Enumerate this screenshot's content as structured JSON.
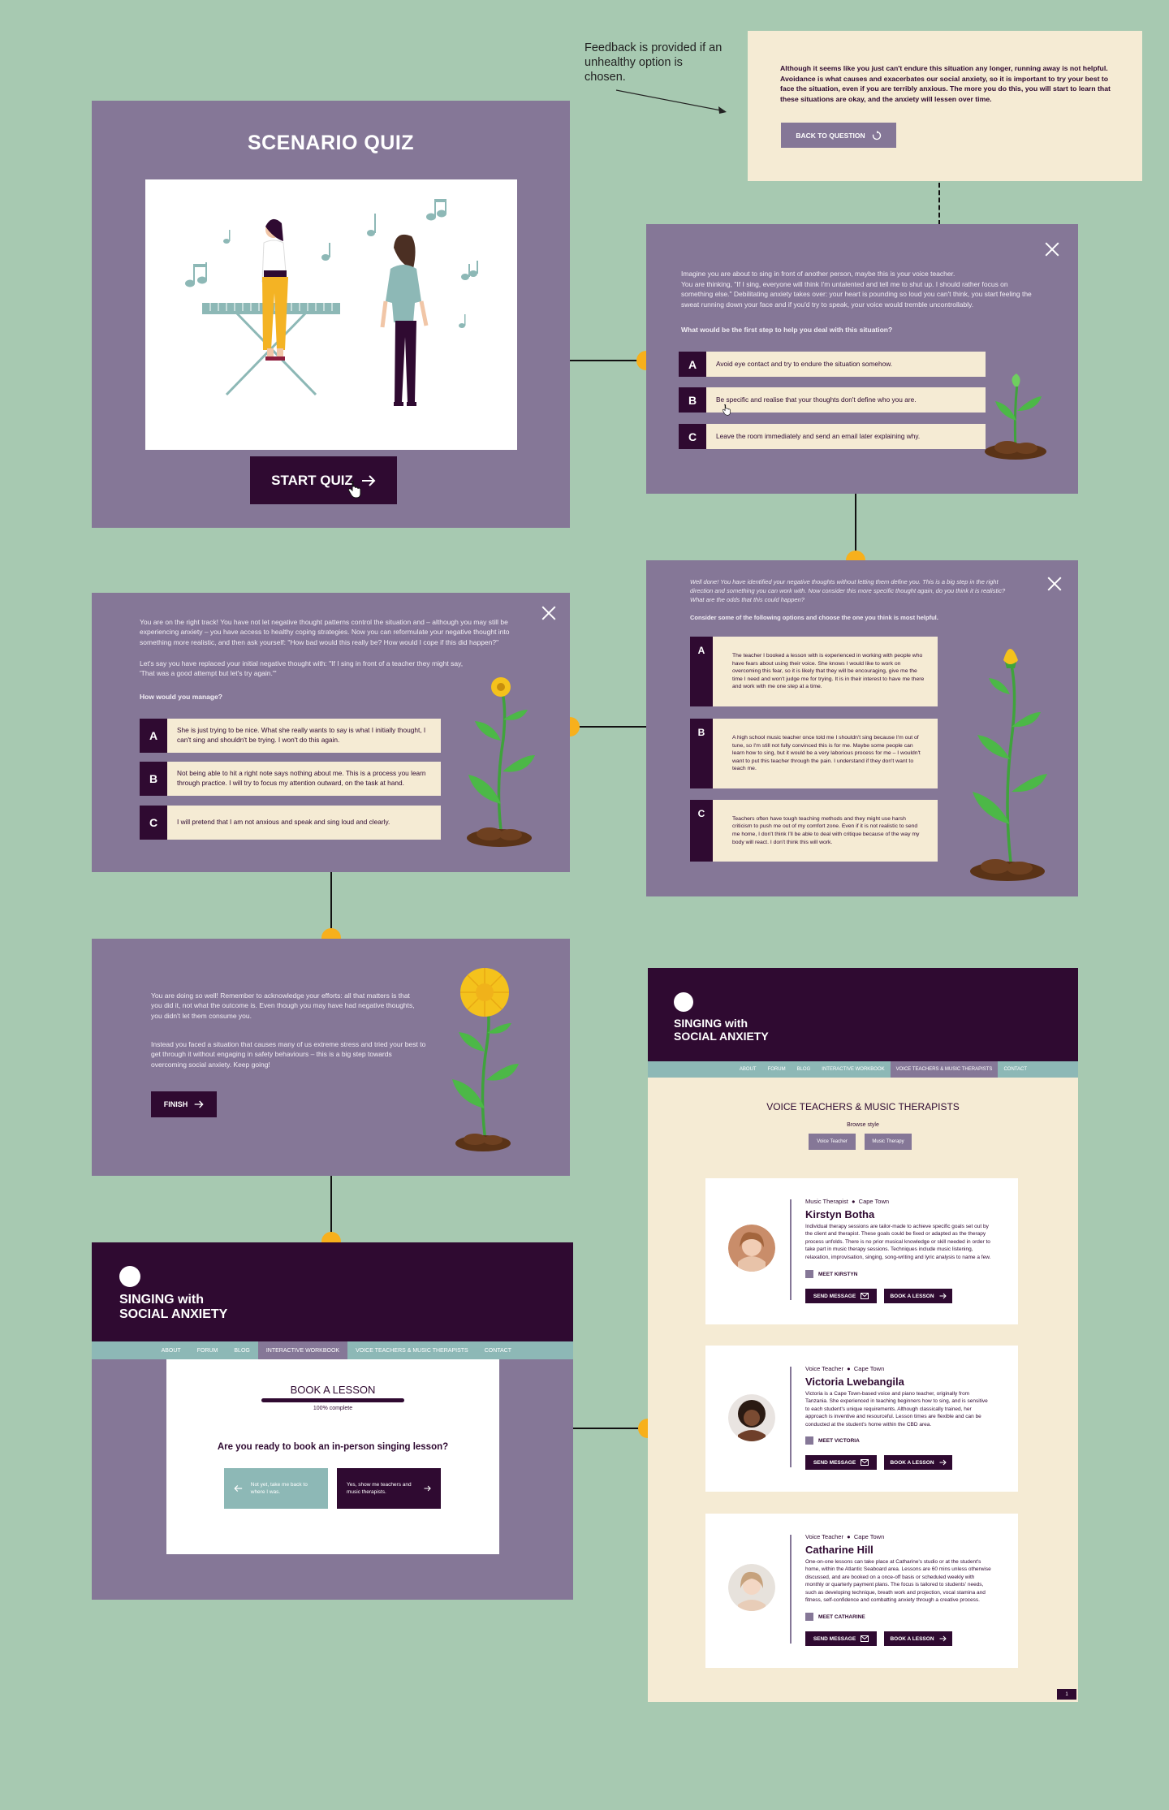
{
  "annotation": {
    "text": "Feedback is provided if an unhealthy option is chosen."
  },
  "feedback": {
    "text": "Although it seems like you just can't endure this situation any longer, running away is not helpful. Avoidance is what causes and exacerbates our social anxiety, so it is important to try your best to face the situation, even if you are terribly anxious. The more you do this, you will start to learn that these situations are okay, and the anxiety will lessen over time.",
    "button": "BACK TO QUESTION"
  },
  "quiz_start": {
    "title": "SCENARIO QUIZ",
    "button": "START QUIZ"
  },
  "q1": {
    "intro_a": "Imagine you are about to sing in front of another person, maybe this is your voice teacher.",
    "intro_b": "You are thinking, \"If I sing, everyone will think I'm untalented and tell me to shut up. I should rather focus on something else.\" Debilitating anxiety takes over: your heart is pounding so loud you can't think, you start feeling the sweat running down your face and if you'd try to speak, your voice would tremble uncontrollably.",
    "question": "What would be the first step to help you deal with this situation?",
    "options": [
      {
        "letter": "A",
        "text": "Avoid eye contact and try to endure the situation somehow."
      },
      {
        "letter": "B",
        "text": "Be specific and realise that your thoughts don't define who you are."
      },
      {
        "letter": "C",
        "text": "Leave the room immediately and send an email later explaining why."
      }
    ]
  },
  "q2": {
    "intro": "Well done! You have identified your negative thoughts without letting them define you. This is a big step in the right direction and something you can work with. Now consider this more specific thought again, do you think it is realistic? What are the odds that this could happen?",
    "question": "Consider some of the following options and choose the one you think is most helpful.",
    "options": [
      {
        "letter": "A",
        "text": "The teacher I booked a lesson with is experienced in working with people who have fears about using their voice. She knows I would like to work on overcoming this fear, so it is likely that they will be encouraging, give me the time I need and won't judge me for trying. It is in their interest to have me there and work with me one step at a time."
      },
      {
        "letter": "B",
        "text": "A high school music teacher once told me I shouldn't sing because I'm out of tune, so I'm still not fully convinced this is for me. Maybe some people can learn how to sing, but it would be a very laborious process for me – I wouldn't want to put this teacher through the pain. I understand if they don't want to teach me."
      },
      {
        "letter": "C",
        "text": "Teachers often have tough teaching methods and they might use harsh criticism to push me out of my comfort zone. Even if it is not realistic to send me home, I don't think I'll be able to deal with critique because of the way my body will react. I don't think this will work."
      }
    ]
  },
  "q3": {
    "intro_a": "You are on the right track! You have not let negative thought patterns control the situation and – although you may still be experiencing anxiety – you have access to healthy coping strategies. Now you can reformulate your negative thought into something more realistic, and then ask yourself: \"How bad would this really be? How would I cope if this did happen?\"",
    "intro_b": "Let's say you have replaced your initial negative thought with: \"If I sing in front of a teacher they might say, 'That was a good attempt but let's try again.'\"",
    "question": "How would you manage?",
    "options": [
      {
        "letter": "A",
        "text": "She is just trying to be nice. What she really wants to say is what I initially thought, I can't sing and shouldn't be trying. I won't do this again."
      },
      {
        "letter": "B",
        "text": "Not being able to hit a right note says nothing about me. This is a process you learn through practice. I will try to focus my attention outward, on the task at hand."
      },
      {
        "letter": "C",
        "text": "I will pretend that I am not anxious and speak and sing loud and clearly."
      }
    ]
  },
  "finish": {
    "p1": "You are doing so well! Remember to acknowledge your efforts: all that matters is that you did it, not what the outcome is. Even though you may have had negative thoughts, you didn't let them consume you.",
    "p2": "Instead you faced a situation that causes many of us extreme stress and tried your best to get through it without engaging in safety behaviours – this is a big step towards overcoming social anxiety. Keep going!",
    "button": "FINISH"
  },
  "site": {
    "title_line1": "SINGING with",
    "title_line2": "SOCIAL ANXIETY",
    "nav": [
      "ABOUT",
      "FORUM",
      "BLOG",
      "INTERACTIVE WORKBOOK",
      "VOICE TEACHERS & MUSIC THERAPISTS",
      "CONTACT"
    ]
  },
  "booking": {
    "title": "BOOK A LESSON",
    "progress_label": "100% complete",
    "progress": 1.0,
    "question": "Are you ready to book an in-person singing lesson?",
    "back": "Not yet, take me back to where I was.",
    "forward": "Yes, show me teachers and music therapists."
  },
  "teachers": {
    "heading": "VOICE TEACHERS & MUSIC THERAPISTS",
    "browse": "Browse style",
    "filters": [
      "Voice Teacher",
      "Music Therapy"
    ],
    "send_label": "SEND MESSAGE",
    "book_label": "BOOK A LESSON",
    "page": "1",
    "cards": [
      {
        "role": "Music Therapist",
        "city": "Cape Town",
        "name": "Kirstyn Botha",
        "bio": "Individual therapy sessions are tailor-made to achieve specific goals set out by the client and therapist. These goals could be fixed or adapted as the therapy process unfolds. There is no prior musical knowledge or skill needed in order to take part in music therapy sessions. Techniques include music listening, relaxation, improvisation, singing, song-writing and lyric analysis to name a few.",
        "meet": "MEET KIRSTYN"
      },
      {
        "role": "Voice Teacher",
        "city": "Cape Town",
        "name": "Victoria Lwebangila",
        "bio": "Victoria is a Cape Town-based voice and piano teacher, originally from Tanzania. She experienced in teaching beginners how to sing, and is sensitive to each student's unique requirements. Although classically trained, her approach is inventive and resourceful. Lesson times are flexible and can be conducted at the student's home within the CBD area.",
        "meet": "MEET VICTORIA"
      },
      {
        "role": "Voice Teacher",
        "city": "Cape Town",
        "name": "Catharine Hill",
        "bio": "One-on-one lessons can take place at Catharine's studio or at the student's home, within the Atlantic Seaboard area. Lessons are 60 mins unless otherwise discussed, and are booked on a once-off basis or scheduled weekly with monthly or quarterly payment plans. The focus is tailored to students' needs, such as developing technique, breath work and projection, vocal stamina and fitness, self-confidence and combatting anxiety through a creative process.",
        "meet": "MEET CATHARINE"
      }
    ]
  },
  "colors": {
    "background": "#a7c9b1",
    "panel": "#857797",
    "dark": "#2f0a31",
    "cream": "#f5ebd4",
    "teal": "#8db8b6",
    "dot": "#f7b01c"
  }
}
